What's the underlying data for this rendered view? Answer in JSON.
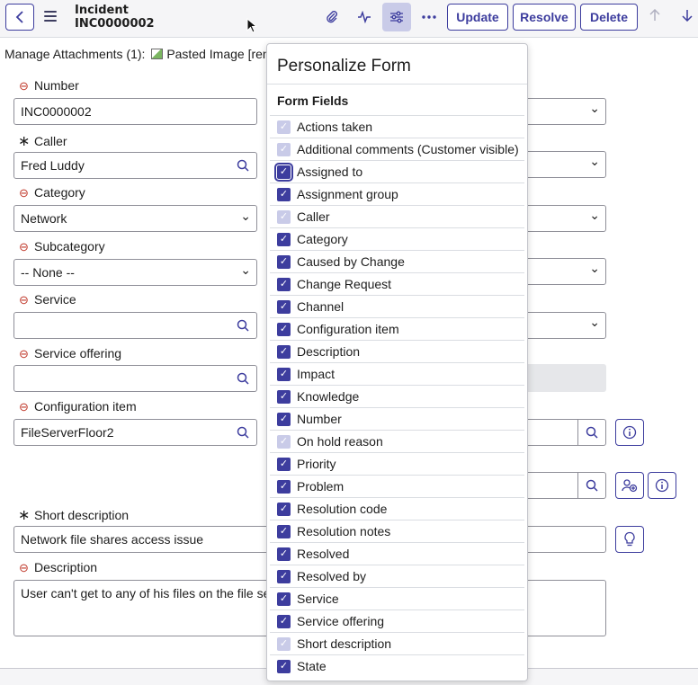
{
  "header": {
    "record_type": "Incident",
    "record_number": "INC0000002",
    "buttons": {
      "update": "Update",
      "resolve": "Resolve",
      "delete": "Delete"
    }
  },
  "attachments": {
    "label": "Manage Attachments (1):",
    "file": "Pasted Image [ren"
  },
  "form": {
    "number": {
      "label": "Number",
      "value": "INC0000002"
    },
    "caller": {
      "label": "Caller",
      "value": "Fred Luddy"
    },
    "category": {
      "label": "Category",
      "value": "Network"
    },
    "subcategory": {
      "label": "Subcategory",
      "value": "-- None --"
    },
    "service": {
      "label": "Service",
      "value": ""
    },
    "service_offering": {
      "label": "Service offering",
      "value": ""
    },
    "configuration_item": {
      "label": "Configuration item",
      "value": "FileServerFloor2"
    },
    "short_description": {
      "label": "Short description",
      "value": "Network file shares access issue"
    },
    "description": {
      "label": "Description",
      "value": "User can't get to any of his files on the file serv"
    }
  },
  "personalize": {
    "title": "Personalize Form",
    "subtitle": "Form Fields",
    "fields": [
      {
        "label": "Actions taken",
        "state": "disabled"
      },
      {
        "label": "Additional comments (Customer visible)",
        "state": "disabled"
      },
      {
        "label": "Assigned to",
        "state": "focused"
      },
      {
        "label": "Assignment group",
        "state": "checked"
      },
      {
        "label": "Caller",
        "state": "disabled"
      },
      {
        "label": "Category",
        "state": "checked"
      },
      {
        "label": "Caused by Change",
        "state": "checked"
      },
      {
        "label": "Change Request",
        "state": "checked"
      },
      {
        "label": "Channel",
        "state": "checked"
      },
      {
        "label": "Configuration item",
        "state": "checked"
      },
      {
        "label": "Description",
        "state": "checked"
      },
      {
        "label": "Impact",
        "state": "checked"
      },
      {
        "label": "Knowledge",
        "state": "checked"
      },
      {
        "label": "Number",
        "state": "checked"
      },
      {
        "label": "On hold reason",
        "state": "disabled"
      },
      {
        "label": "Priority",
        "state": "checked"
      },
      {
        "label": "Problem",
        "state": "checked"
      },
      {
        "label": "Resolution code",
        "state": "checked"
      },
      {
        "label": "Resolution notes",
        "state": "checked"
      },
      {
        "label": "Resolved",
        "state": "checked"
      },
      {
        "label": "Resolved by",
        "state": "checked"
      },
      {
        "label": "Service",
        "state": "checked"
      },
      {
        "label": "Service offering",
        "state": "checked"
      },
      {
        "label": "Short description",
        "state": "disabled"
      },
      {
        "label": "State",
        "state": "checked"
      }
    ]
  },
  "colors": {
    "accent": "#3d3d9e",
    "disabled_check": "#c9cbe8",
    "mandatory_mark": "#c0392b"
  }
}
